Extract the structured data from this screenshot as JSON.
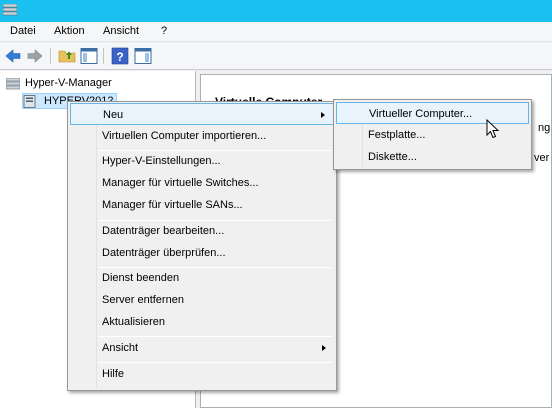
{
  "menubar": {
    "items": [
      "Datei",
      "Aktion",
      "Ansicht",
      "?"
    ]
  },
  "tree": {
    "root_label": "Hyper-V-Manager",
    "server_label": "HYPERV2012"
  },
  "right": {
    "header": "Virtuelle Computer",
    "frag1": "ng",
    "frag2": "ver"
  },
  "context_menu": {
    "items": [
      {
        "label": "Neu"
      },
      {
        "label": "Virtuellen Computer importieren..."
      },
      {
        "label": "Hyper-V-Einstellungen..."
      },
      {
        "label": "Manager für virtuelle Switches..."
      },
      {
        "label": "Manager für virtuelle SANs..."
      },
      {
        "label": "Datenträger bearbeiten..."
      },
      {
        "label": "Datenträger überprüfen..."
      },
      {
        "label": "Dienst beenden"
      },
      {
        "label": "Server entfernen"
      },
      {
        "label": "Aktualisieren"
      },
      {
        "label": "Ansicht"
      },
      {
        "label": "Hilfe"
      }
    ]
  },
  "submenu": {
    "items": [
      {
        "label": "Virtueller Computer..."
      },
      {
        "label": "Festplatte..."
      },
      {
        "label": "Diskette..."
      }
    ]
  },
  "colors": {
    "titlebar": "#19c0f0",
    "highlight_bg": "#e8f3fc",
    "highlight_border": "#6ab4e8"
  }
}
